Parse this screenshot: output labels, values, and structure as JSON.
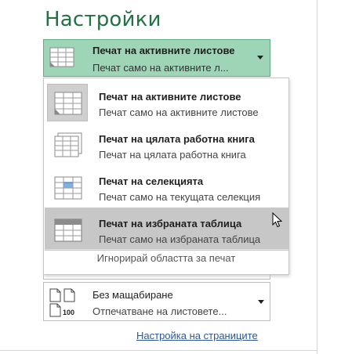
{
  "section": {
    "title": "Настройки"
  },
  "print_what": {
    "selected_title": "Печат на активните листове",
    "selected_subtitle": "Печат само на активните л...",
    "options": [
      {
        "title": "Печат на активните листове",
        "subtitle": "Печат само на активните листове",
        "icon": "active-sheets-icon"
      },
      {
        "title": "Печат на цялата работна книга",
        "subtitle": "Печат на цялата работна книга",
        "icon": "entire-workbook-icon"
      },
      {
        "title": "Печат на селекцията",
        "subtitle": "Печат само на текущата селекция",
        "icon": "selection-icon"
      },
      {
        "title": "Печат на избраната таблица",
        "subtitle": "Печат само на избраната таблица",
        "icon": "table-icon"
      }
    ],
    "ignore_print_area": "Игнорирай областта за печат"
  },
  "scaling": {
    "title": "Без мащабиране",
    "subtitle": "Отпечатване на листовете...",
    "icon_label": "100"
  },
  "page_setup_link": "Настройка на страниците",
  "colors": {
    "accent": "#217346",
    "selected_bg": "#9fd5b7",
    "hover_bg": "#c7c7c7",
    "link": "#2b579a"
  }
}
